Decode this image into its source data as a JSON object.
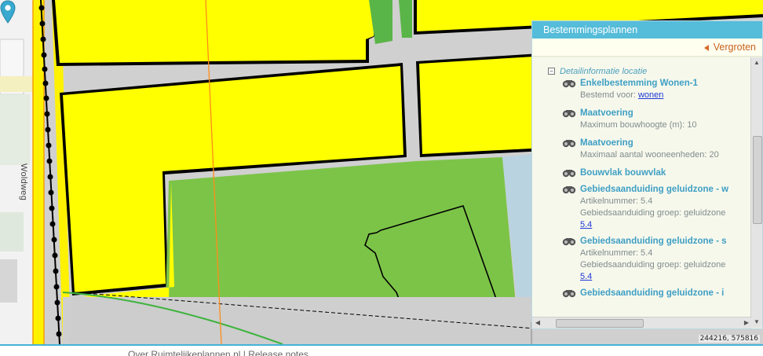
{
  "map": {
    "road_name": "Woldweg",
    "coordinates": "244216, 575816",
    "colors": {
      "residential": "#ffff00",
      "green": "#7cc448",
      "road": "#cdcdcd",
      "rail": "#000000"
    }
  },
  "panel": {
    "title": "Bestemmingsplannen",
    "expand_label": "Vergroten",
    "section_title": "Detailinformatie locatie",
    "items": [
      {
        "title": "Enkelbestemming Wonen-1",
        "lines": [
          "Bestemd voor: "
        ],
        "link": "wonen"
      },
      {
        "title": "Maatvoering",
        "lines": [
          "Maximum bouwhoogte (m): 10"
        ]
      },
      {
        "title": "Maatvoering",
        "lines": [
          "Maximaal aantal wooneenheden: 20"
        ]
      },
      {
        "title": "Bouwvlak bouwvlak",
        "lines": []
      },
      {
        "title": "Gebiedsaanduiding geluidzone - w",
        "lines": [
          "Artikelnummer: 5.4",
          "Gebiedsaanduiding groep: geluidzone"
        ],
        "link2": "5.4"
      },
      {
        "title": "Gebiedsaanduiding geluidzone - s",
        "lines": [
          "Artikelnummer: 5.4",
          "Gebiedsaanduiding groep: geluidzone"
        ],
        "link2": "5.4"
      },
      {
        "title": "Gebiedsaanduiding geluidzone - i",
        "lines": []
      }
    ]
  },
  "footer": {
    "about_link": "Over Ruimtelijkeplannen.nl",
    "separator": "|",
    "release_link": "Release notes"
  }
}
